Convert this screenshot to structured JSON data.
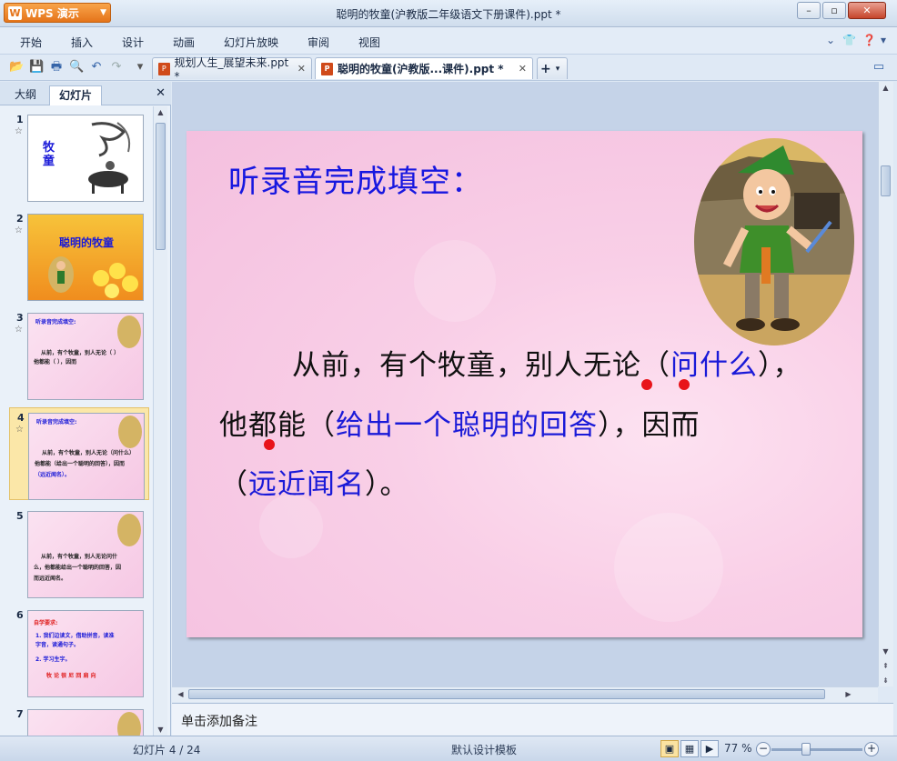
{
  "app": {
    "name": "WPS 演示",
    "logo": "W"
  },
  "window": {
    "title": "聪明的牧童(沪教版二年级语文下册课件).ppt *"
  },
  "menu": [
    "开始",
    "插入",
    "设计",
    "动画",
    "幻灯片放映",
    "审阅",
    "视图"
  ],
  "tabs": [
    {
      "label": "规划人生_展望未来.ppt *"
    },
    {
      "label": "聪明的牧童(沪教版...课件).ppt *"
    }
  ],
  "panel": {
    "tab_outline": "大纲",
    "tab_slides": "幻灯片"
  },
  "thumbnails": [
    {
      "num": "1",
      "title": "牧童"
    },
    {
      "num": "2",
      "title": "聪明的牧童"
    },
    {
      "num": "3",
      "title": "听录音完成填空:"
    },
    {
      "num": "4",
      "title": "听录音完成填空:"
    },
    {
      "num": "5",
      "line1": "从前，有个牧童，别人无论问什",
      "line2": "么，他都能给出一个聪明的回答，因",
      "line3": "而远近闻名。"
    },
    {
      "num": "6",
      "title": "自学要求:",
      "line1": "1. 我们边读文，借助拼音，读准",
      "line2": "字音，读通句子。",
      "line3": "2. 学习生字。",
      "chars": "牧 论 很 尼 回 肩 向"
    },
    {
      "num": "7"
    }
  ],
  "slide": {
    "title": "听录音完成填空：",
    "line1_a": "从前，有个牧童，别人无论（",
    "line1_fill": "问什么",
    "line1_b": "），",
    "line2_a": "他都能（",
    "line2_fill": "给出一个聪明的回答",
    "line2_b": "），因而",
    "line3_a": "（",
    "line3_fill": "远近闻名",
    "line3_b": "）。"
  },
  "notes": {
    "placeholder": "单击添加备注"
  },
  "status": {
    "slide_counter": "幻灯片 4 / 24",
    "template": "默认设计模板",
    "zoom": "77 %"
  },
  "colors": {
    "accent_blue": "#1a1ad8",
    "marker_red": "#e8141a",
    "app_orange": "#e5741a"
  }
}
